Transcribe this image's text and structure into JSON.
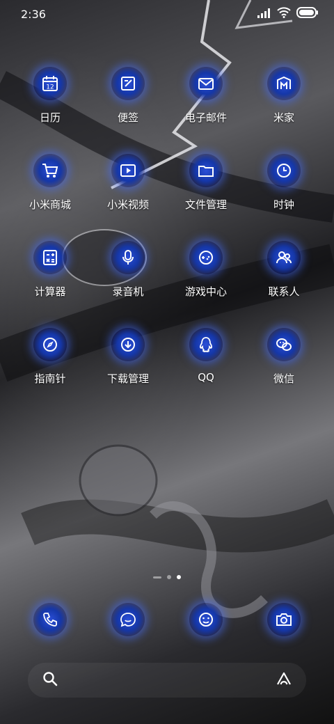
{
  "status_bar": {
    "time": "2:36",
    "icons": [
      "signal-icon",
      "wifi-icon",
      "battery-icon"
    ]
  },
  "apps": [
    {
      "label": "日历",
      "icon": "calendar-icon"
    },
    {
      "label": "便签",
      "icon": "notes-icon"
    },
    {
      "label": "电子邮件",
      "icon": "mail-icon"
    },
    {
      "label": "米家",
      "icon": "mijia-icon"
    },
    {
      "label": "小米商城",
      "icon": "shopping-cart-icon"
    },
    {
      "label": "小米视频",
      "icon": "video-icon"
    },
    {
      "label": "文件管理",
      "icon": "folder-icon"
    },
    {
      "label": "时钟",
      "icon": "clock-icon"
    },
    {
      "label": "计算器",
      "icon": "calculator-icon"
    },
    {
      "label": "录音机",
      "icon": "microphone-icon"
    },
    {
      "label": "游戏中心",
      "icon": "gamepad-icon"
    },
    {
      "label": "联系人",
      "icon": "contacts-icon"
    },
    {
      "label": "指南针",
      "icon": "compass-icon"
    },
    {
      "label": "下载管理",
      "icon": "download-icon"
    },
    {
      "label": "QQ",
      "icon": "qq-icon"
    },
    {
      "label": "微信",
      "icon": "wechat-icon"
    }
  ],
  "calendar_day": "12",
  "page_indicator": {
    "count": 3,
    "active_index": 2
  },
  "dock": [
    {
      "icon": "phone-icon"
    },
    {
      "icon": "messages-icon"
    },
    {
      "icon": "browser-icon"
    },
    {
      "icon": "camera-icon"
    }
  ],
  "search_bar": {
    "left_icon": "search-icon",
    "right_icon": "assistant-icon"
  },
  "colors": {
    "icon_glow": "#466eff",
    "icon_fill": "#1537a8"
  }
}
